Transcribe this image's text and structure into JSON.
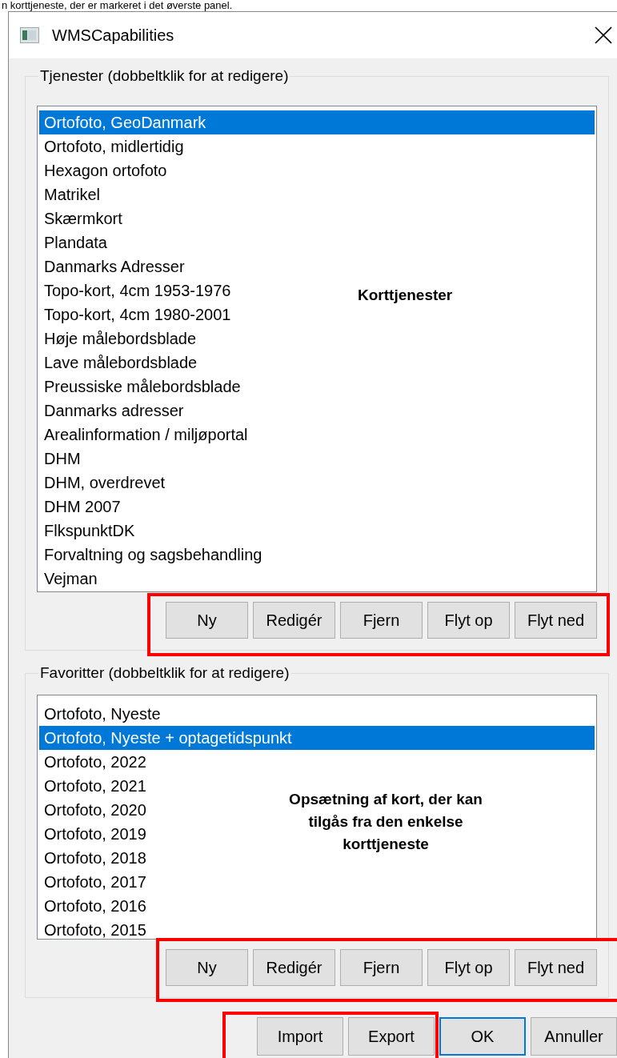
{
  "caption": "n korttjeneste, der er markeret i det øverste panel.",
  "window": {
    "title": "WMSCapabilities"
  },
  "groups": [
    {
      "title": "Tjenester (dobbeltklik for at redigere)",
      "annotation": "Korttjenester",
      "items": [
        {
          "label": "Ortofoto, GeoDanmark",
          "selected": true
        },
        {
          "label": "Ortofoto, midlertidig",
          "selected": false
        },
        {
          "label": "Hexagon ortofoto",
          "selected": false
        },
        {
          "label": "Matrikel",
          "selected": false
        },
        {
          "label": "Skærmkort",
          "selected": false
        },
        {
          "label": "Plandata",
          "selected": false
        },
        {
          "label": "Danmarks Adresser",
          "selected": false
        },
        {
          "label": "Topo-kort, 4cm 1953-1976",
          "selected": false
        },
        {
          "label": "Topo-kort, 4cm 1980-2001",
          "selected": false
        },
        {
          "label": "Høje målebordsblade",
          "selected": false
        },
        {
          "label": "Lave målebordsblade",
          "selected": false
        },
        {
          "label": "Preussiske målebordsblade",
          "selected": false
        },
        {
          "label": "Danmarks adresser",
          "selected": false
        },
        {
          "label": "Arealinformation / miljøportal",
          "selected": false
        },
        {
          "label": "DHM",
          "selected": false
        },
        {
          "label": "DHM, overdrevet",
          "selected": false
        },
        {
          "label": "DHM 2007",
          "selected": false
        },
        {
          "label": "FlkspunktDK",
          "selected": false
        },
        {
          "label": "Forvaltning og sagsbehandling",
          "selected": false
        },
        {
          "label": "Vejman",
          "selected": false
        }
      ],
      "buttons": [
        "Ny",
        "Redigér",
        "Fjern",
        "Flyt op",
        "Flyt ned"
      ]
    },
    {
      "title": "Favoritter (dobbeltklik for at redigere)",
      "annotation": "Opsætning af kort, der kan tilgås fra den enkelse korttjeneste",
      "items": [
        {
          "label": "Ortofoto, Nyeste",
          "selected": false
        },
        {
          "label": "Ortofoto, Nyeste + optagetidspunkt",
          "selected": true
        },
        {
          "label": "Ortofoto, 2022",
          "selected": false
        },
        {
          "label": "Ortofoto, 2021",
          "selected": false
        },
        {
          "label": "Ortofoto, 2020",
          "selected": false
        },
        {
          "label": "Ortofoto, 2019",
          "selected": false
        },
        {
          "label": "Ortofoto, 2018",
          "selected": false
        },
        {
          "label": "Ortofoto, 2017",
          "selected": false
        },
        {
          "label": "Ortofoto, 2016",
          "selected": false
        },
        {
          "label": "Ortofoto, 2015",
          "selected": false
        }
      ],
      "buttons": [
        "Ny",
        "Redigér",
        "Fjern",
        "Flyt op",
        "Flyt ned"
      ]
    }
  ],
  "dialog_buttons": [
    {
      "label": "Import",
      "default": false
    },
    {
      "label": "Export",
      "default": false
    },
    {
      "label": "OK",
      "default": true
    },
    {
      "label": "Annuller",
      "default": false
    }
  ]
}
